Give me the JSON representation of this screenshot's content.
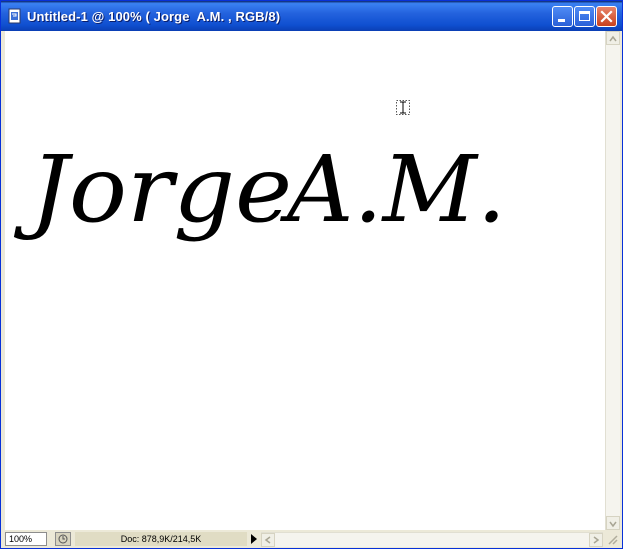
{
  "window": {
    "title": "Untitled-1 @ 100% ( Jorge  A.M. , RGB/8)",
    "icon": "photoshop-document-icon"
  },
  "controls": {
    "minimize_icon": "minimize-icon",
    "maximize_icon": "maximize-icon",
    "close_icon": "close-icon"
  },
  "canvas": {
    "text_word1": "Jorge",
    "text_word2": "A.M.",
    "text_color": "#000000",
    "background": "#ffffff",
    "cursor_icon": "text-cursor-icon"
  },
  "status": {
    "zoom": "100%",
    "doc_info": "Doc: 878,9K/214,5K"
  }
}
